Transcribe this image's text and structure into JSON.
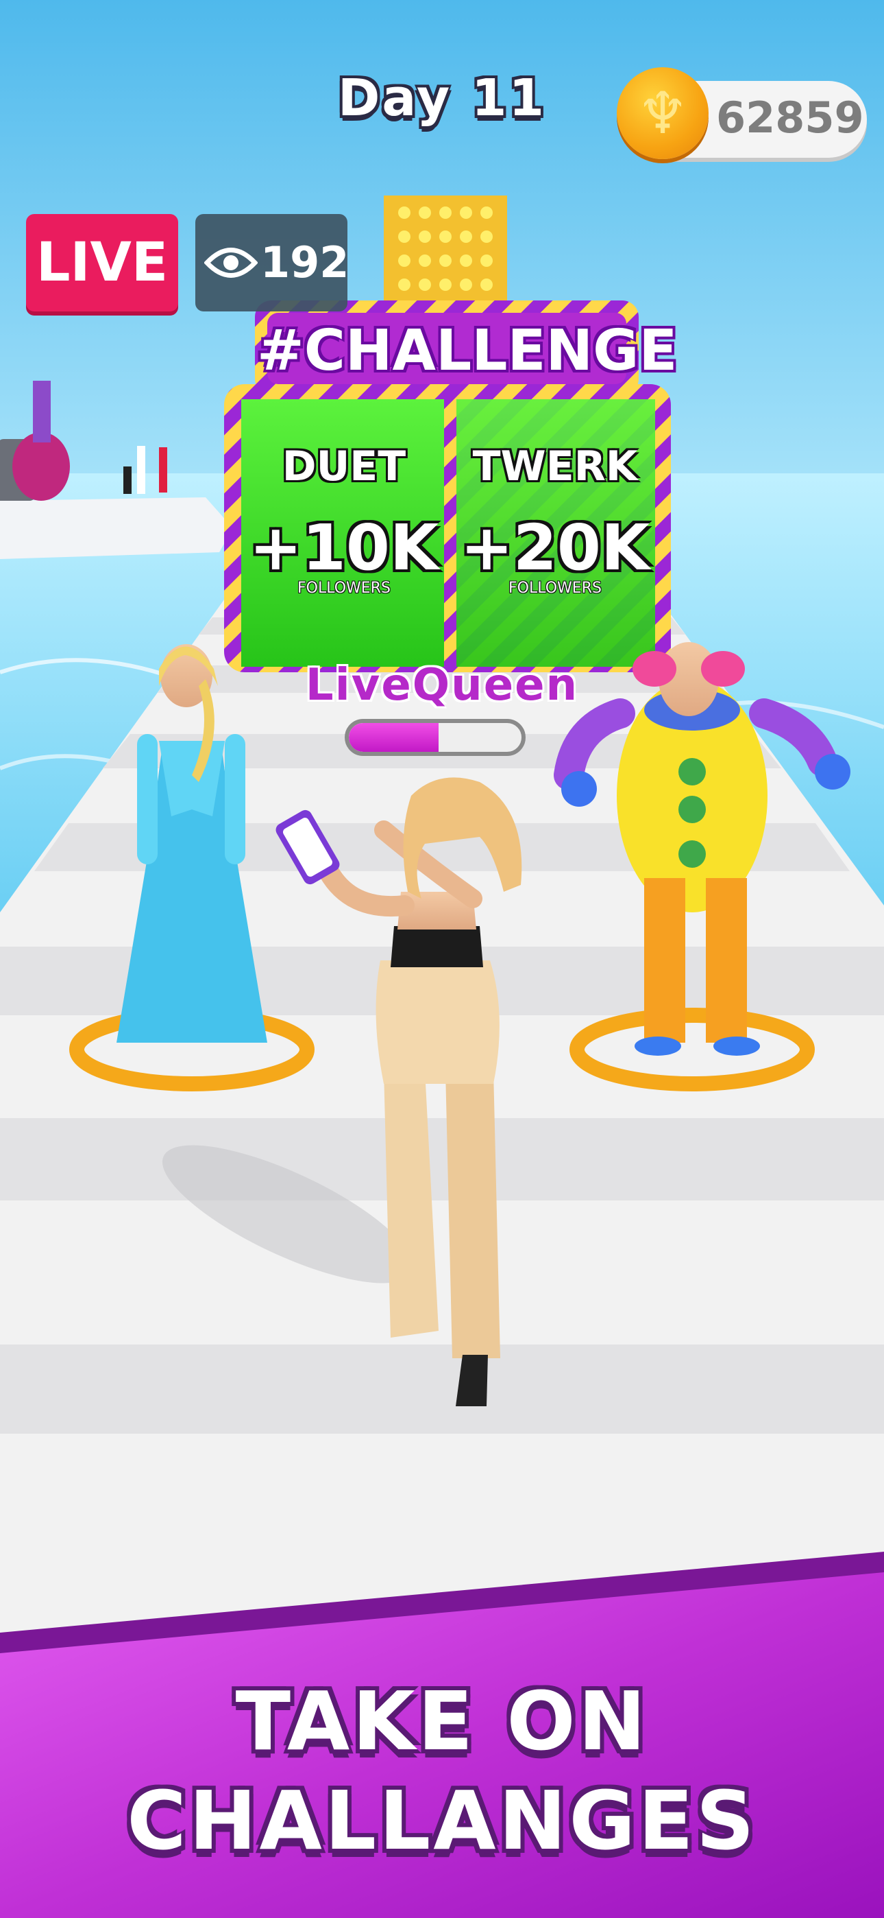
{
  "hud": {
    "day_label": "Day 11",
    "coins": "62859",
    "coin_glyph": "♆",
    "live_label": "LIVE",
    "viewer_count": "192"
  },
  "challenge": {
    "title": "#CHALLENGE",
    "options": [
      {
        "name": "DUET",
        "value": "+10K",
        "unit": "FOLLOWERS"
      },
      {
        "name": "TWERK",
        "value": "+20K",
        "unit": "FOLLOWERS"
      }
    ]
  },
  "player": {
    "name": "LiveQueen",
    "progress": 0.52
  },
  "banner": {
    "line1": "TAKE ON",
    "line2": "CHALLANGES"
  },
  "colors": {
    "accent": "#b529c9",
    "live": "#ea1c5e",
    "gate_green": "#3fd82a",
    "banner_purple": "#c832d8"
  },
  "icons": [
    "coin-icon",
    "eye-icon"
  ]
}
